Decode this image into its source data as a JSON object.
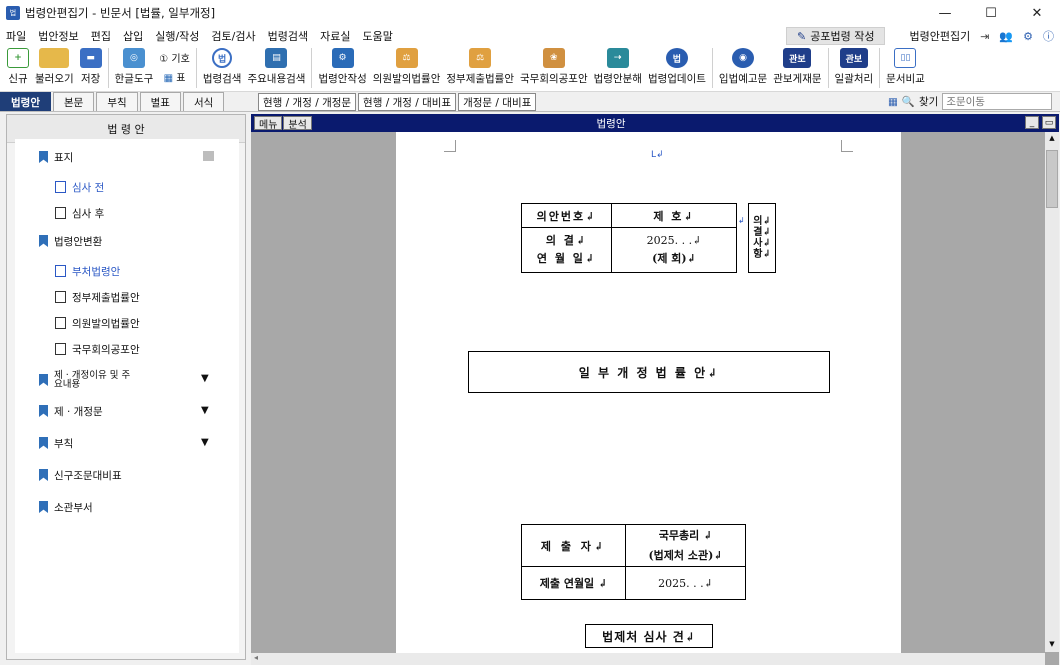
{
  "window": {
    "title": "법령안편집기 - 빈문서 [법률, 일부개정]",
    "app_icon": "법",
    "min": "—",
    "max": "☐",
    "close": "✕"
  },
  "menu": [
    "파일",
    "법안정보",
    "편집",
    "삽입",
    "실행/작성",
    "검토/검사",
    "법령검색",
    "자료실",
    "도움말"
  ],
  "menu_right": {
    "compose": "공포법령 작성",
    "editor": "법령안편집기"
  },
  "toolbar": [
    {
      "label": "신규",
      "color": "#3a9a3a"
    },
    {
      "label": "불러오기",
      "color": "#e6b84a"
    },
    {
      "label": "저장",
      "color": "#3b6fc4"
    },
    {
      "label": "한글도구",
      "color": "#4a90d0"
    },
    {
      "label": "법령검색",
      "color": "#3b6fc4"
    },
    {
      "label": "주요내용검색",
      "color": "#2f6fb0"
    },
    {
      "label": "법령안작성",
      "color": "#2a6bb8"
    },
    {
      "label": "의원발의법률안",
      "color": "#e0a040"
    },
    {
      "label": "정부제출법률안",
      "color": "#e0a040"
    },
    {
      "label": "국무회의공포안",
      "color": "#d09040"
    },
    {
      "label": "법령안분해",
      "color": "#2a8a9a"
    },
    {
      "label": "법령업데이트",
      "color": "#2a5db0"
    },
    {
      "label": "입법예고문",
      "color": "#2a5db0"
    },
    {
      "label": "관보게재문",
      "color": "#1f3e8a"
    },
    {
      "label": "일괄처리",
      "color": "#1f3e8a"
    },
    {
      "label": "문서비교",
      "color": "#3b6fc4"
    }
  ],
  "toolbar_small": {
    "symbol": "① 기호",
    "table": "표"
  },
  "tabs": [
    "법령안",
    "본문",
    "부칙",
    "별표",
    "서식"
  ],
  "view_tabs": [
    "현행 / 개정 / 개정문",
    "현행 / 개정 / 대비표",
    "개정문 / 대비표"
  ],
  "find": {
    "label": "찾기",
    "placeholder": "조문이동"
  },
  "sidebar": {
    "title": "법 령 안",
    "items": [
      {
        "label": "표지",
        "kind": "bookmark"
      },
      {
        "label": "심사 전",
        "kind": "doc",
        "active": true
      },
      {
        "label": "심사 후",
        "kind": "doc"
      },
      {
        "label": "법령안변환",
        "kind": "bookmark"
      },
      {
        "label": "부처법령안",
        "kind": "doc",
        "active": true
      },
      {
        "label": "정부제출법률안",
        "kind": "doc"
      },
      {
        "label": "의원발의법률안",
        "kind": "doc"
      },
      {
        "label": "국무회의공포안",
        "kind": "doc"
      },
      {
        "label": "제 · 개정이유 및 주요내용",
        "kind": "bookmark",
        "caret": true
      },
      {
        "label": "제 · 개정문",
        "kind": "bookmark",
        "caret": true
      },
      {
        "label": "부칙",
        "kind": "bookmark",
        "caret": true
      },
      {
        "label": "신구조문대비표",
        "kind": "bookmark"
      },
      {
        "label": "소관부서",
        "kind": "bookmark"
      }
    ]
  },
  "doc": {
    "menu_btn": "메뉴",
    "analysis_btn": "분석",
    "title": "법령안",
    "cursor_mark": "L↲",
    "info_table": {
      "row1_label": "의안번호↲",
      "row1_value": "제    호↲",
      "row2_label_a": "의    결↲",
      "row2_label_b": "연 월 일↲",
      "row2_value_a": "2025.   .   .↲",
      "row2_value_b": "(제    회)↲"
    },
    "side_box": [
      "의↲",
      "결↲",
      "사↲",
      "항↲"
    ],
    "bill_title": "일 부 개 정 법 률 안↲",
    "submit_table": {
      "submitter_label": "제 출 자↲",
      "submitter_value_a": "국무총리 ↲",
      "submitter_value_b": "(법제처 소관)↲",
      "date_label": "제출 연월일 ↲",
      "date_value": "2025.    .    .↲"
    },
    "review_box": "법제처 심사 견↲"
  }
}
